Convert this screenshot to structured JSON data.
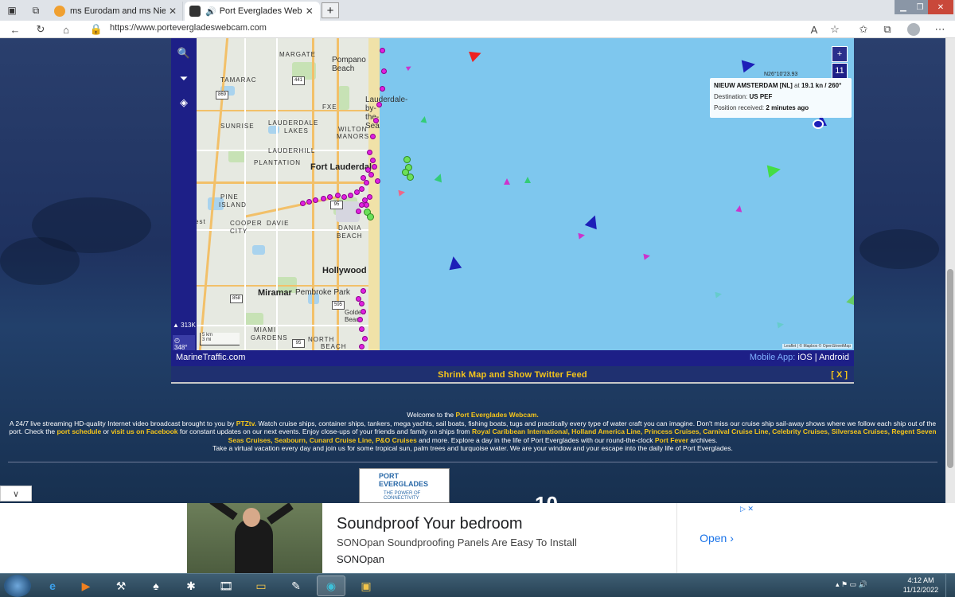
{
  "browser": {
    "tabs": [
      {
        "title": "ms Eurodam and ms Nieuw State",
        "active": false
      },
      {
        "title": "Port Everglades Webcam - A",
        "active": true
      }
    ],
    "new_tab": "+",
    "url": "https://www.portevergladeswebcam.com"
  },
  "map": {
    "labels": {
      "margate": "MARGATE",
      "pompano": "Pompano Beach",
      "tamarac": "TAMARAC",
      "lauderdale_sea": "Lauderdale-",
      "lauderdale_sea2": "by-the-Sea",
      "fxe": "FXE",
      "sunrise": "SUNRISE",
      "lauderdale_lakes": "LAUDERDALE",
      "lakes": "LAKES",
      "wilton": "WILTON",
      "manors": "MANORS",
      "lauderhill": "LAUDERHILL",
      "plantation": "PLANTATION",
      "fort_lauderdale": "Fort Lauderdale",
      "pine": "PINE",
      "island": "ISLAND",
      "cooper": "COOPER",
      "city": "CITY",
      "davie": "DAVIE",
      "dania": "DANIA",
      "beach": "BEACH",
      "west": "est",
      "hollywood": "Hollywood",
      "miramar": "Miramar",
      "pembroke": "Pembroke Park",
      "golden": "Golden Beach",
      "miami_gardens": "MIAMI",
      "gardens": "GARDENS",
      "north": "NORTH",
      "north_beach": "BEACH"
    },
    "shields": [
      "441",
      "869",
      "858",
      "95",
      "595",
      "95"
    ],
    "sidebar": {
      "search": "search-icon",
      "filter": "filter-icon",
      "layers": "layers-icon",
      "vessel_count": "313K",
      "heading": "348°"
    },
    "scale": {
      "km": "5 km",
      "mi": "3 mi"
    },
    "zoom": {
      "plus": "+",
      "level": "11"
    },
    "coords": "N26°10'23.93",
    "popup": {
      "vessel": "NIEUW AMSTERDAM [NL]",
      "speed_prefix": "at",
      "speed": "19.1 kn / 260°",
      "destination_label": "Destination:",
      "destination": "US PEF",
      "position_label": "Position received:",
      "position_time": "2 minutes ago"
    },
    "attribution": "Leaflet | © Mapbox © OpenStreetMap"
  },
  "marinetraffic": {
    "brand": "MarineTraffic.com",
    "mobile_label": "Mobile App:",
    "ios": "iOS",
    "sep": "|",
    "android": "Android"
  },
  "shrink": {
    "text": "Shrink Map and Show Twitter Feed",
    "close": "[ X ]"
  },
  "welcome": {
    "line1_pre": "Welcome to the ",
    "line1_bold": "Port Everglades Webcam.",
    "p1": "A 24/7 live streaming HD-quality Internet video broadcast brought to you by ",
    "ptztv": "PTZtv.",
    "p2": " Watch cruise ships, container ships, tankers, mega yachts, sail boats, fishing boats, tugs and practically every type of water craft you can imagine. Don't miss our cruise ship sail-away shows where we follow each ship out of the port. Check the ",
    "schedule": "port schedule",
    "or": " or ",
    "facebook": "visit us on Facebook",
    "p3": " for constant updates on our next events. Enjoy close-ups of your friends and family on ships from ",
    "lines": "Royal Caribbean International, Holland America Line, Princess Cruises, Carnival Cruise Line, Celebrity Cruises, Silversea Cruises, Regent Seven Seas Cruises, Seabourn, Cunard Cruise Line, P&O Cruises",
    "p4": " and more. Explore a day in the life of Port Everglades with our round-the-clock ",
    "fever": "Port Fever",
    "p5": " archives.",
    "p6": "Take a virtual vacation every day and join us for some tropical sun, palm trees and turquoise water. We are your window and your escape into the daily life of Port Everglades."
  },
  "logo": {
    "name": "PORT EVERGLADES",
    "tagline": "THE POWER OF CONNECTIVITY"
  },
  "big_number": "10",
  "ad": {
    "title": "Soundproof Your bedroom",
    "description": "SONOpan Soundproofing Panels Are Easy To Install",
    "brand": "SONOpan",
    "cta": "Open",
    "choices": "▷ ✕"
  },
  "taskbar": {
    "time": "4:12 AM",
    "date": "11/12/2022"
  },
  "colors": {
    "map_sea": "#7ec7ee",
    "mt_blue": "#1d1f87",
    "accent_yellow": "#f5c51a",
    "vessel_passenger": "#e020e0"
  }
}
